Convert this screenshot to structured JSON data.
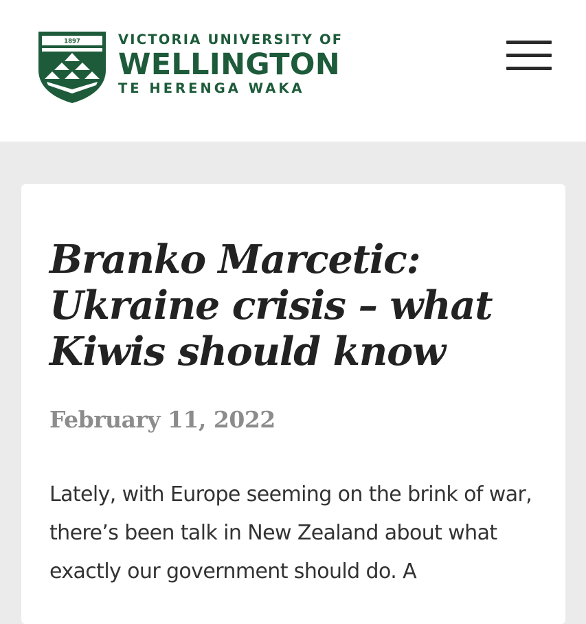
{
  "header": {
    "logo": {
      "founded_year": "1897",
      "line1": "VICTORIA UNIVERSITY OF",
      "line2": "WELLINGTON",
      "line3": "TE HERENGA WAKA"
    },
    "menu_icon": "hamburger-menu-icon",
    "brand_color": "#1d5b3a"
  },
  "article": {
    "title": "Branko Marcetic: Ukraine crisis – what Kiwis should know",
    "date": "February 11, 2022",
    "body": "Lately, with Europe seeming on the brink of war, there’s been talk in New Zealand about what exactly our government should do. A"
  },
  "colors": {
    "page_background": "#ebebeb",
    "card_background": "#ffffff",
    "title_color": "#222222",
    "date_color": "#8c8c8c",
    "text_color": "#333333"
  }
}
